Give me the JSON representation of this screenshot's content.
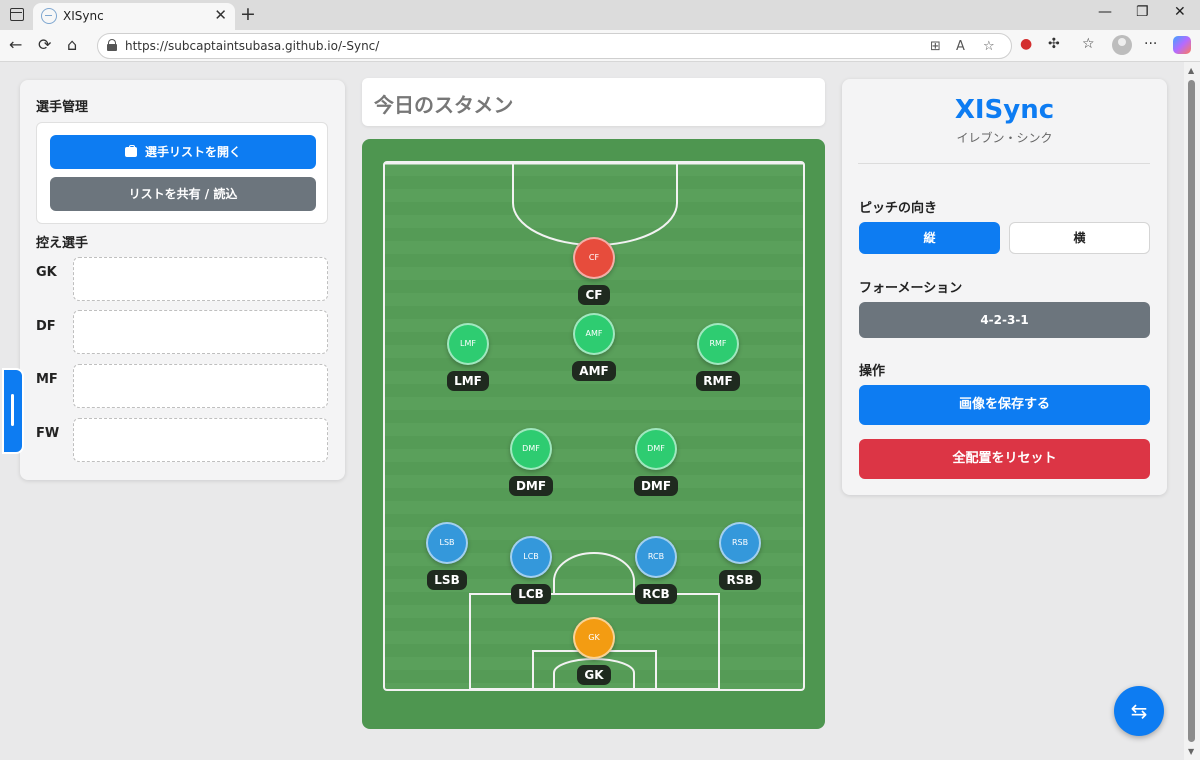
{
  "browser": {
    "tab_title": "XISync",
    "tab_close": "✕",
    "new_tab": "+",
    "url": "https://subcaptaintsubasa.github.io/-Sync/",
    "back": "←",
    "reload": "⟳",
    "home": "⌂",
    "menu": "···",
    "minimize": "—",
    "restore": "❐",
    "close": "✕"
  },
  "left_panel": {
    "section_title": "選手管理",
    "open_list_button": "選手リストを開く",
    "share_button": "リストを共有 / 読込",
    "bench_title": "控え選手",
    "bench_rows": [
      "GK",
      "DF",
      "MF",
      "FW"
    ]
  },
  "center": {
    "lineup_title": "今日のスタメン",
    "players": [
      {
        "pos": "CF",
        "label": "CF",
        "color": "#e74c3c"
      },
      {
        "pos": "LMF",
        "label": "LMF",
        "color": "#2ecc71"
      },
      {
        "pos": "AMF",
        "label": "AMF",
        "color": "#2ecc71"
      },
      {
        "pos": "RMF",
        "label": "RMF",
        "color": "#2ecc71"
      },
      {
        "pos": "DMF",
        "label": "DMF",
        "color": "#2ecc71"
      },
      {
        "pos": "DMF",
        "label": "DMF",
        "color": "#2ecc71"
      },
      {
        "pos": "LSB",
        "label": "LSB",
        "color": "#3498db"
      },
      {
        "pos": "LCB",
        "label": "LCB",
        "color": "#3498db"
      },
      {
        "pos": "RCB",
        "label": "RCB",
        "color": "#3498db"
      },
      {
        "pos": "RSB",
        "label": "RSB",
        "color": "#3498db"
      },
      {
        "pos": "GK",
        "label": "GK",
        "color": "#f39c12"
      }
    ]
  },
  "right_panel": {
    "brand": "XISync",
    "brand_sub": "イレブン・シンク",
    "orientation_title": "ピッチの向き",
    "orientation_vertical": "縦",
    "orientation_horizontal": "横",
    "formation_title": "フォーメーション",
    "formation_value": "4-2-3-1",
    "actions_title": "操作",
    "save_image_button": "画像を保存する",
    "reset_button": "全配置をリセット"
  },
  "colors": {
    "accent": "#0d7cf2",
    "danger": "#dc3545",
    "secondary": "#6c757d",
    "pitch": "#5aa05b"
  },
  "fab_icon": "⇆"
}
